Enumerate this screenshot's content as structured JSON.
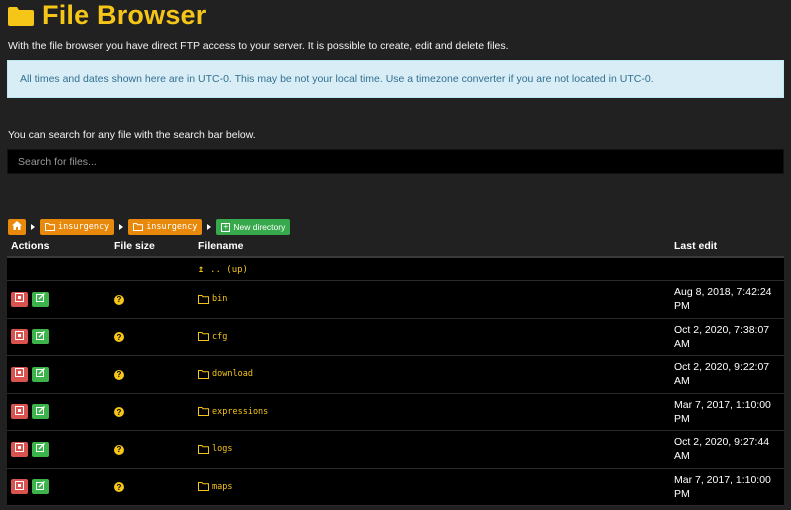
{
  "header": {
    "title": "File Browser",
    "icon": "folder-icon",
    "accent_color": "#f5c518"
  },
  "intro_text": "With the file browser you have direct FTP access to your server. It is possible to create, edit and delete files.",
  "notice": "All times and dates shown here are in UTC-0. This may be not your local time. Use a timezone converter if you are not located in UTC-0.",
  "search": {
    "note": "You can search for any file with the search bar below.",
    "placeholder": "Search for files...",
    "value": ""
  },
  "breadcrumb": {
    "home_icon": "home-icon",
    "items": [
      "insurgency",
      "insurgency"
    ],
    "new_directory_label": "New directory"
  },
  "table": {
    "headers": {
      "actions": "Actions",
      "size": "File size",
      "name": "Filename",
      "edit": "Last edit"
    },
    "up_label": ".. (up)",
    "rows": [
      {
        "name": "bin",
        "edit_line1": "Aug 8, 2018, 7:42:24",
        "edit_line2": "PM"
      },
      {
        "name": "cfg",
        "edit_line1": "Oct 2, 2020, 7:38:07",
        "edit_line2": "AM"
      },
      {
        "name": "download",
        "edit_line1": "Oct 2, 2020, 9:22:07",
        "edit_line2": "AM"
      },
      {
        "name": "expressions",
        "edit_line1": "Mar 7, 2017, 1:10:00",
        "edit_line2": "PM"
      },
      {
        "name": "logs",
        "edit_line1": "Oct 2, 2020, 9:27:44",
        "edit_line2": "AM"
      },
      {
        "name": "maps",
        "edit_line1": "Mar 7, 2017, 1:10:00",
        "edit_line2": "PM"
      }
    ]
  },
  "colors": {
    "background": "#212121",
    "info_bg": "#d9edf7",
    "breadcrumb": "#e8890c",
    "new_dir": "#37a94c",
    "delete": "#d9534f",
    "edit": "#3cb44b"
  }
}
